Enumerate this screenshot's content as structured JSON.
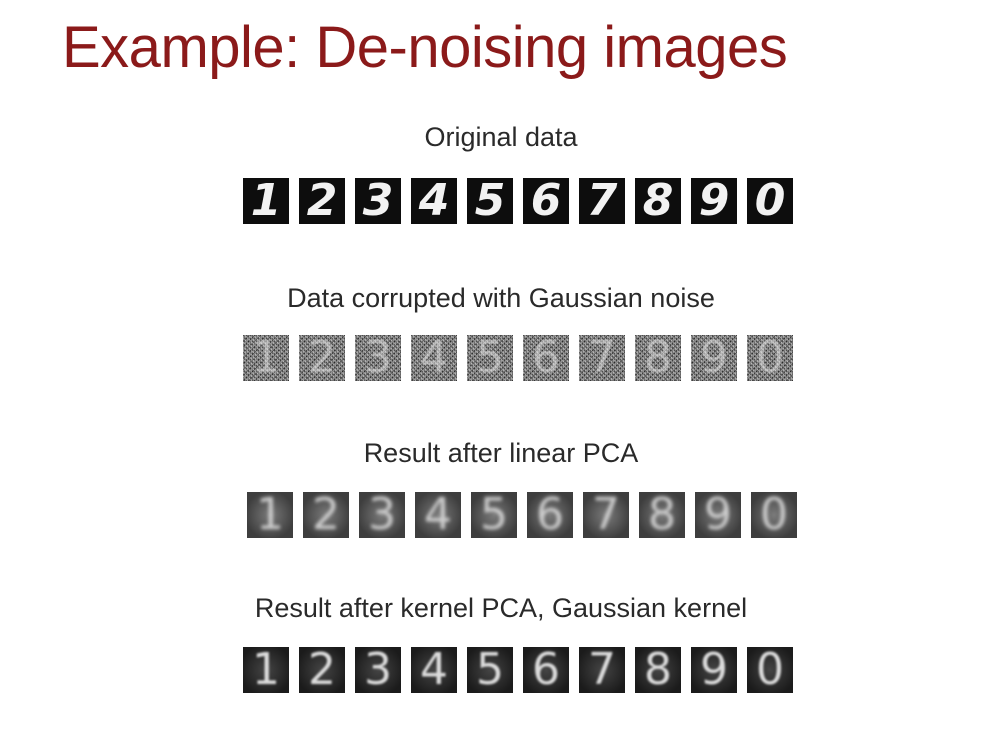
{
  "slide": {
    "title": "Example: De-noising images",
    "title_color": "#8b1a1a"
  },
  "digits": [
    "1",
    "2",
    "3",
    "4",
    "5",
    "6",
    "7",
    "8",
    "9",
    "0"
  ],
  "panels": [
    {
      "caption": "Original data",
      "style": "clean"
    },
    {
      "caption": "Data corrupted with Gaussian noise",
      "style": "noisy"
    },
    {
      "caption": "Result after linear PCA",
      "style": "linear"
    },
    {
      "caption": "Result after kernel PCA, Gaussian kernel",
      "style": "kernel"
    }
  ]
}
